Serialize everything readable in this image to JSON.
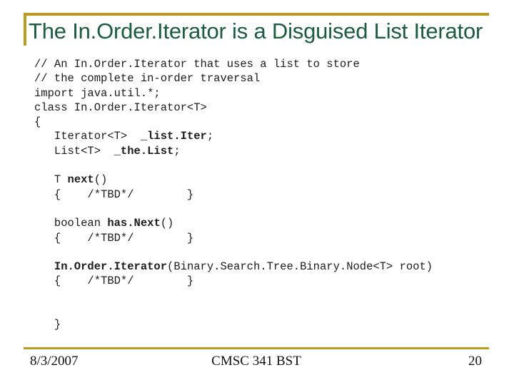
{
  "slide": {
    "title": "The In.Order.Iterator is a Disguised List Iterator",
    "accent_color": "#bc9b22",
    "title_color": "#1a5c3d",
    "code_color": "#1c1c1c",
    "background_color": "#ffffff"
  },
  "code": {
    "lines": [
      {
        "text": "// An In.Order.Iterator that uses a list to store",
        "bold": null
      },
      {
        "text": "// the complete in-order traversal",
        "bold": null
      },
      {
        "text": "import java.util.*;",
        "bold": null
      },
      {
        "text": "class In.Order.Iterator<T>",
        "bold": null
      },
      {
        "text": "{",
        "bold": null
      },
      {
        "text": "   Iterator<T>  _list.Iter;",
        "bold": "_list.Iter"
      },
      {
        "text": "   List<T>  _the.List;",
        "bold": "_the.List"
      },
      {
        "text": "",
        "bold": null
      },
      {
        "text": "   T next()",
        "bold": "next"
      },
      {
        "text": "   {    /*TBD*/        }",
        "bold": null
      },
      {
        "text": "",
        "bold": null
      },
      {
        "text": "   boolean has.Next()",
        "bold": "has.Next"
      },
      {
        "text": "   {    /*TBD*/        }",
        "bold": null
      },
      {
        "text": "",
        "bold": null
      },
      {
        "text": "   In.Order.Iterator(Binary.Search.Tree.Binary.Node<T> root)",
        "bold": "In.Order.Iterator"
      },
      {
        "text": "   {    /*TBD*/        }",
        "bold": null
      },
      {
        "text": "",
        "bold": null
      },
      {
        "text": "",
        "bold": null
      },
      {
        "text": "   }",
        "bold": null
      }
    ]
  },
  "footer": {
    "date": "8/3/2007",
    "center": "CMSC 341 BST",
    "page_number": "20"
  }
}
